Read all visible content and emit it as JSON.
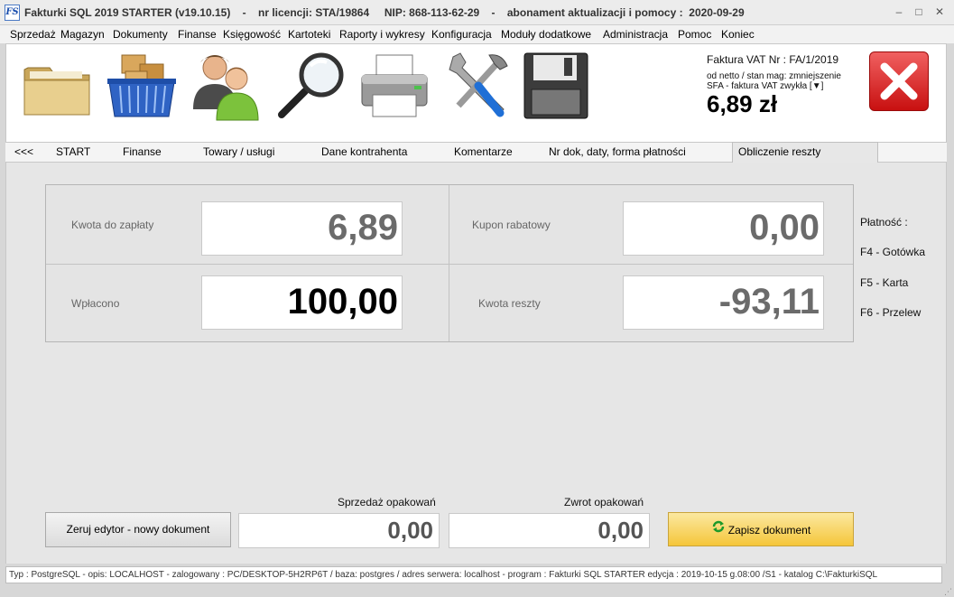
{
  "titlebar": {
    "app_icon": "FS",
    "title": "Fakturki SQL 2019 STARTER (v19.10.15)    -    nr licencji: STA/19864     NIP: 868-113-62-29    -    abonament aktualizacji i pomocy :  2020-09-29",
    "minimize": "–",
    "maximize": "□",
    "close": "✕"
  },
  "menu": [
    "Sprzedaż",
    "Magazyn",
    "Dokumenty",
    "Finanse",
    "Księgowość",
    "Kartoteki",
    "Raporty i wykresy",
    "Konfiguracja",
    "Moduły dodatkowe",
    "Administracja",
    "Pomoc",
    "Koniec"
  ],
  "toolbar": {
    "icons": [
      "folder-icon",
      "basket-icon",
      "users-icon",
      "magnifier-icon",
      "printer-icon",
      "tools-icon",
      "floppy-disk-icon"
    ],
    "doc_label": "Faktura VAT Nr :  FA/1/2019",
    "doc_mode": "od netto / stan mag: zmniejszenie",
    "doc_type": "SFA - faktura VAT zwykła [▼]",
    "doc_amount": "6,89 zł",
    "close_icon": "close-x-icon"
  },
  "tabs": [
    "<<<",
    "START",
    "Finanse",
    "Towary  / usługi",
    "Dane kontrahenta",
    "Komentarze",
    "Nr dok, daty, forma płatności",
    "Obliczenie reszty"
  ],
  "fields": {
    "kwota_label": "Kwota do zapłaty",
    "kwota_value": "6,89",
    "kupon_label": "Kupon rabatowy",
    "kupon_value": "0,00",
    "wplacono_label": "Wpłacono",
    "wplacono_value": "100,00",
    "reszta_label": "Kwota reszty",
    "reszta_value": "-93,11"
  },
  "payment": {
    "title": "Płatność :",
    "f4": "F4 - Gotówka",
    "f5": "F5 - Karta",
    "f6": "F6 - Przelew"
  },
  "bottom": {
    "reset_button": "Zeruj edytor -  nowy dokument",
    "sprzedaz_label": "Sprzedaż opakowań",
    "sprzedaz_value": "0,00",
    "zwrot_label": "Zwrot opakowań",
    "zwrot_value": "0,00",
    "save_button": "Zapisz dokument"
  },
  "status": "Typ : PostgreSQL - opis: LOCALHOST  -  zalogowany : PC/DESKTOP-5H2RP6T  / baza: postgres / adres serwera: localhost  -  program :  Fakturki SQL STARTER edycja : 2019-10-15 g.08:00 /S1 - katalog C:\\FakturkiSQL"
}
